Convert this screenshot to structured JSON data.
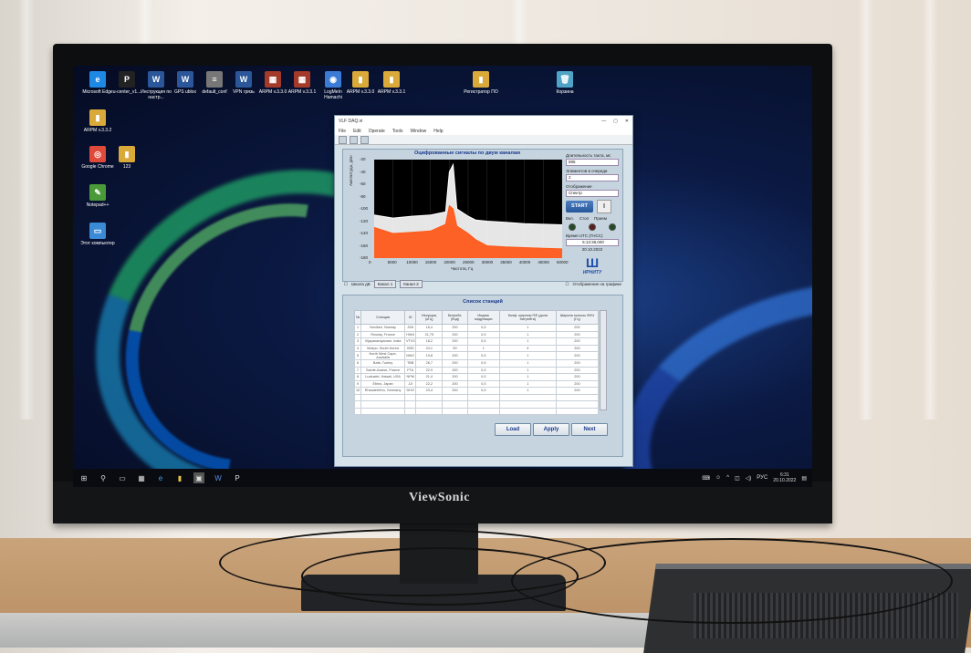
{
  "desktop_icons": [
    {
      "label": "Microsoft Edge",
      "glyph": "e",
      "color": "#1e88e5"
    },
    {
      "label": "u-center_v1...",
      "glyph": "P",
      "color": "#222222"
    },
    {
      "label": "Инструкция по настр...",
      "glyph": "W",
      "color": "#2b579a"
    },
    {
      "label": "GPS ublox",
      "glyph": "W",
      "color": "#2b579a"
    },
    {
      "label": "default_conf",
      "glyph": "≡",
      "color": "#777777"
    },
    {
      "label": "VPN грязь",
      "glyph": "W",
      "color": "#2b579a"
    },
    {
      "label": "ARPM v.3.3.0",
      "glyph": "▦",
      "color": "#a33a2a"
    },
    {
      "label": "ARPM v.3.3.1",
      "glyph": "▦",
      "color": "#a33a2a"
    },
    {
      "label": "LogMeIn Hamachi",
      "glyph": "◉",
      "color": "#3a7bd5"
    },
    {
      "label": "ARPM v.3.3.0",
      "glyph": "▮",
      "color": "#d9a93a"
    },
    {
      "label": "ARPM v.3.3.1",
      "glyph": "▮",
      "color": "#d9a93a"
    },
    {
      "label": "Регистратор ПО",
      "glyph": "▮",
      "color": "#d9a93a"
    },
    {
      "label": "Корзина",
      "glyph": "🗑",
      "color": "#4fa3c7"
    },
    {
      "label": "ARPM v.3.3.2",
      "glyph": "▮",
      "color": "#d9a93a"
    },
    {
      "label": "Google Chrome",
      "glyph": "◎",
      "color": "#e04a3a"
    },
    {
      "label": "123",
      "glyph": "▮",
      "color": "#d9a93a"
    },
    {
      "label": "Notepad++",
      "glyph": "✎",
      "color": "#4a9a3a"
    },
    {
      "label": "Этот компьютер",
      "glyph": "▭",
      "color": "#3a8ad5"
    }
  ],
  "window": {
    "title": "VLF DAQ.vi",
    "menu": [
      "File",
      "Edit",
      "Operate",
      "Tools",
      "Window",
      "Help"
    ],
    "plot_title": "Оцифрованные сигналы по двум каналам",
    "y_axis_label": "Амплитуда, дБн",
    "x_axis_label": "Частота, Гц",
    "scale_checkbox": "Шкала дБ",
    "channel1": "Канал 1",
    "channel2": "Канал 2",
    "display_checkbox": "Отображение на графике",
    "side": {
      "duration_label": "Длительность такта, мс",
      "duration_value": "895",
      "elements_label": "Элементов в очереди",
      "elements_value": "2",
      "display_label": "Отображение",
      "display_value": "Спектр",
      "start_label": "START",
      "stop_label": "||",
      "led_labels": [
        "Вкл.",
        "Стоп",
        "Прием"
      ],
      "utc_label": "Время UTC (ГНСС)",
      "utc_time": "5:13:38,000",
      "utc_date": "20.10.2022",
      "logo_text": "ИРНИТУ"
    },
    "table_title": "Список станций",
    "table_headers": [
      "№",
      "Станция",
      "ID",
      "Несущая, (кГц)",
      "Битрейт, (бод)",
      "Индекс модуляции",
      "Коэф. ширины ПФ (доли битрейта)",
      "Ширина полосы ФНЧ (Гц)"
    ],
    "table_rows": [
      [
        "1",
        "Noviken, Norway",
        "JXN",
        "16,4",
        "200",
        "0,5",
        "1",
        "200"
      ],
      [
        "2",
        "Rosnay, France",
        "HWU",
        "21,75",
        "200",
        "0,5",
        "1",
        "200"
      ],
      [
        "3",
        "Vijayanarayanam, India",
        "VTX3",
        "18,2",
        "200",
        "0,5",
        "1",
        "200"
      ],
      [
        "4",
        "Mokpo, South Korea",
        "XBD",
        "24,1",
        "50",
        "1",
        "4",
        "200"
      ],
      [
        "5",
        "North West Cape, Australia",
        "NWC",
        "19,8",
        "200",
        "0,5",
        "1",
        "200"
      ],
      [
        "6",
        "Bafa, Turkey",
        "TBB",
        "26,7",
        "200",
        "0,5",
        "1",
        "200"
      ],
      [
        "7",
        "Sainte-Assise, France",
        "FTA",
        "22,9",
        "200",
        "0,5",
        "1",
        "200"
      ],
      [
        "8",
        "Lualualei, Hawaii, USA",
        "NPM",
        "21,4",
        "200",
        "0,5",
        "1",
        "200"
      ],
      [
        "9",
        "Ebino, Japan",
        "JJI",
        "22,2",
        "200",
        "0,5",
        "1",
        "200"
      ],
      [
        "10",
        "Rhauderfehn, Germany",
        "DHO",
        "23,4",
        "200",
        "0,5",
        "1",
        "200"
      ]
    ],
    "buttons": {
      "load": "Load",
      "apply": "Apply",
      "next": "Next"
    }
  },
  "chart_data": {
    "type": "line",
    "title": "Оцифрованные сигналы по двум каналам",
    "xlabel": "Частота, Гц",
    "ylabel": "Амплитуда, дБн",
    "xlim": [
      0,
      50000
    ],
    "ylim": [
      -180,
      -20
    ],
    "x_ticks": [
      "0",
      "5000",
      "10000",
      "15000",
      "20000",
      "25000",
      "30000",
      "35000",
      "40000",
      "45000",
      "50000"
    ],
    "y_ticks": [
      "-20",
      "-40",
      "-60",
      "-80",
      "-100",
      "-120",
      "-140",
      "-160",
      "-180"
    ],
    "series": [
      {
        "color": "#ffffff",
        "x": [
          0,
          5000,
          10000,
          15000,
          19000,
          20000,
          21000,
          22000,
          25000,
          27000,
          30000,
          35000,
          40000,
          45000,
          50000
        ],
        "y": [
          -110,
          -115,
          -112,
          -110,
          -105,
          -40,
          -28,
          -100,
          -112,
          -118,
          -120,
          -122,
          -124,
          -125,
          -126
        ]
      },
      {
        "color": "#ff5a1a",
        "x": [
          0,
          5000,
          10000,
          15000,
          19000,
          20000,
          21000,
          22000,
          25000,
          27000,
          30000,
          35000,
          40000,
          45000,
          50000
        ],
        "y": [
          -130,
          -140,
          -138,
          -136,
          -125,
          -95,
          -100,
          -128,
          -140,
          -150,
          -160,
          -162,
          -163,
          -164,
          -165
        ]
      }
    ]
  },
  "taskbar": {
    "tray_lang": "РУС",
    "time": "6:31",
    "date": "20.10.2022"
  },
  "monitor_brand": "ViewSonic"
}
